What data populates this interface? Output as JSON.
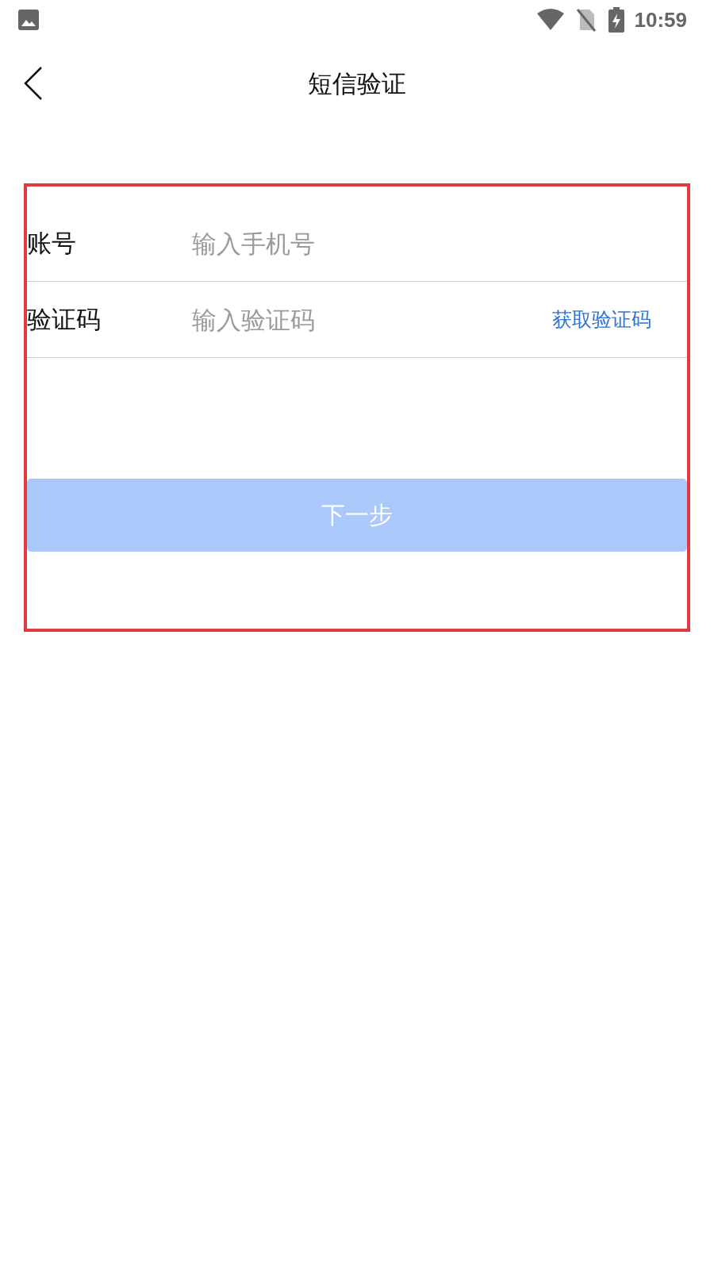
{
  "status_bar": {
    "time": "10:59"
  },
  "header": {
    "title": "短信验证"
  },
  "form": {
    "fields": [
      {
        "label": "账号",
        "placeholder": "输入手机号"
      },
      {
        "label": "验证码",
        "placeholder": "输入验证码",
        "action": "获取验证码"
      }
    ],
    "submit": {
      "label": "下一步",
      "disabled": true
    }
  }
}
